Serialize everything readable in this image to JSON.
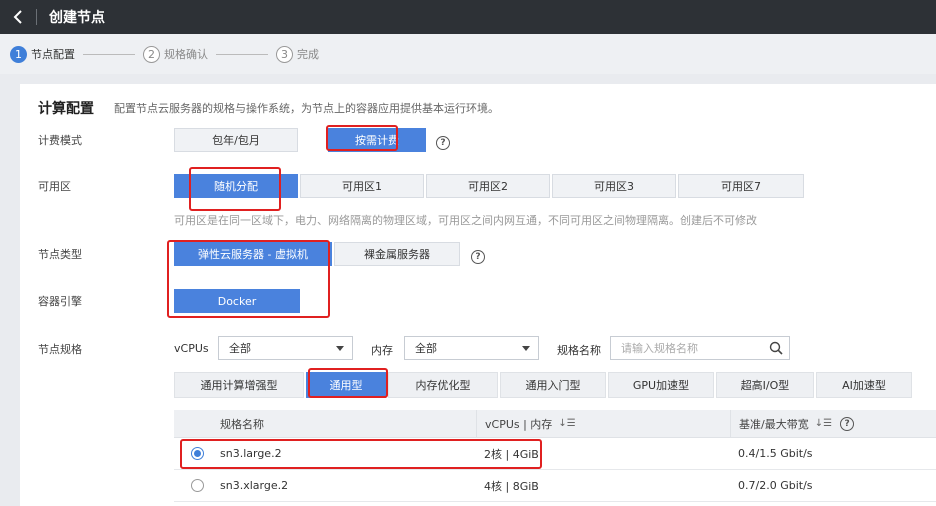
{
  "header": {
    "title": "创建节点"
  },
  "steps": [
    {
      "num": "1",
      "label": "节点配置"
    },
    {
      "num": "2",
      "label": "规格确认"
    },
    {
      "num": "3",
      "label": "完成"
    }
  ],
  "section": {
    "title": "计算配置",
    "desc": "配置节点云服务器的规格与操作系统，为节点上的容器应用提供基本运行环境。"
  },
  "billing": {
    "label": "计费模式",
    "options": [
      "包年/包月",
      "按需计费"
    ],
    "selected": "按需计费"
  },
  "az": {
    "label": "可用区",
    "options": [
      "随机分配",
      "可用区1",
      "可用区2",
      "可用区3",
      "可用区7"
    ],
    "selected": "随机分配",
    "hint": "可用区是在同一区域下，电力、网络隔离的物理区域，可用区之间内网互通，不同可用区之间物理隔离。创建后不可修改"
  },
  "node_type": {
    "label": "节点类型",
    "options": [
      "弹性云服务器 - 虚拟机",
      "裸金属服务器"
    ],
    "selected": "弹性云服务器 - 虚拟机"
  },
  "engine": {
    "label": "容器引擎",
    "options": [
      "Docker"
    ],
    "selected": "Docker"
  },
  "spec": {
    "label": "节点规格",
    "vcpus_label": "vCPUs",
    "vcpus_value": "全部",
    "mem_label": "内存",
    "mem_value": "全部",
    "name_label": "规格名称",
    "name_placeholder": "请输入规格名称",
    "tabs": [
      "通用计算增强型",
      "通用型",
      "内存优化型",
      "通用入门型",
      "GPU加速型",
      "超高I/O型",
      "AI加速型"
    ],
    "selected_tab": "通用型",
    "columns": [
      "规格名称",
      "vCPUs | 内存",
      "基准/最大带宽"
    ],
    "rows": [
      {
        "name": "sn3.large.2",
        "cpu_mem": "2核 | 4GiB",
        "bandwidth": "0.4/1.5 Gbit/s",
        "selected": true
      },
      {
        "name": "sn3.xlarge.2",
        "cpu_mem": "4核 | 8GiB",
        "bandwidth": "0.7/2.0 Gbit/s",
        "selected": false
      }
    ]
  },
  "icons": {
    "back": "chevron-left-icon",
    "help": "question-circle-icon",
    "search": "search-icon",
    "sort": "sort-icon",
    "dropdown": "caret-down-icon"
  },
  "colors": {
    "accent": "#4a82dd",
    "header_bg": "#2d3136",
    "annotation": "#e02020"
  }
}
